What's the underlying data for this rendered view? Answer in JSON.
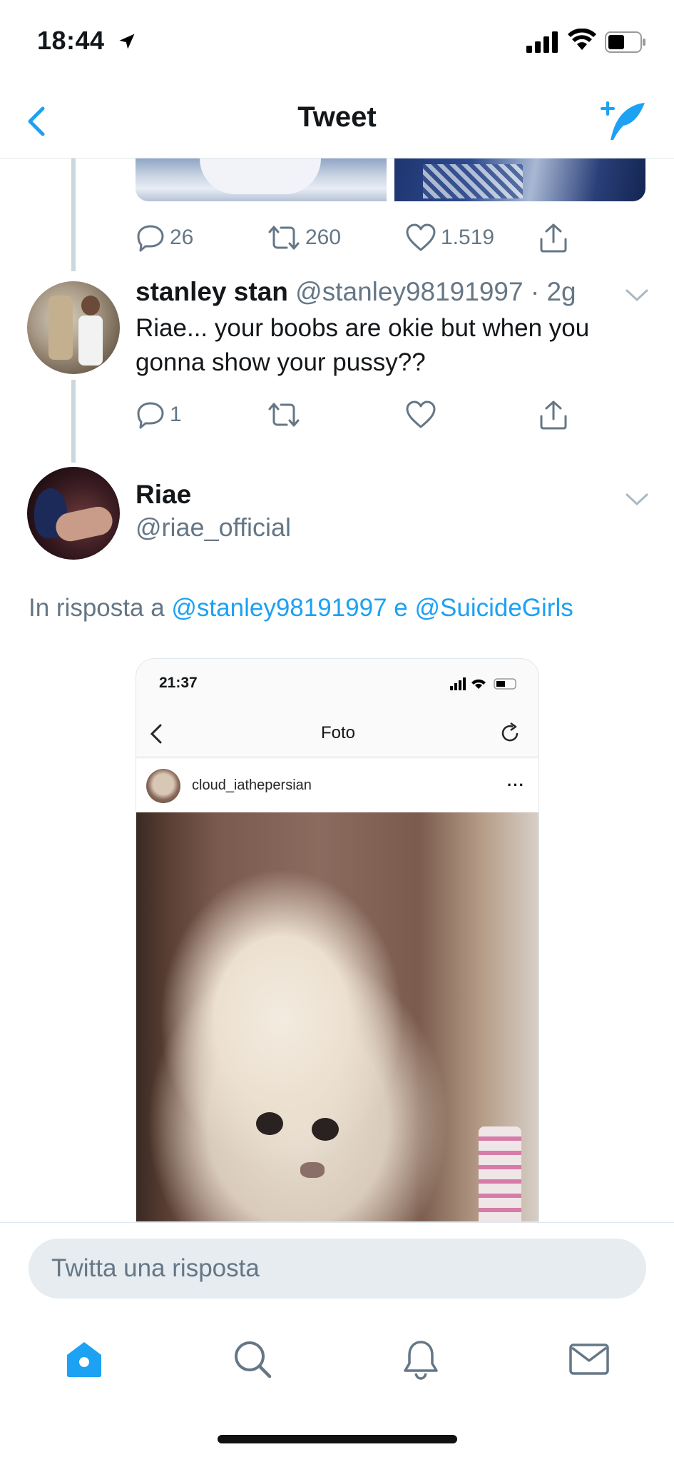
{
  "status_bar": {
    "time": "18:44"
  },
  "nav": {
    "title": "Tweet"
  },
  "parent_tweet_actions": {
    "replies": "26",
    "retweets": "260",
    "likes": "1.519"
  },
  "reply_tweet": {
    "name": "stanley stan",
    "handle": "@stanley98191997",
    "time": "· 2g",
    "text": "Riae... your boobs are okie but when you gonna show your pussy??",
    "replies": "1"
  },
  "main_tweet": {
    "name": "Riae",
    "handle": "@riae_official",
    "reply_prefix": "In risposta a",
    "reply_user_1": "@stanley98191997",
    "reply_joiner": "e",
    "reply_user_2": "@SuicideGirls",
    "embedded_screenshot": {
      "time": "21:37",
      "title": "Foto",
      "username": "cloud_iathepersian",
      "menu": "···"
    }
  },
  "reply_bar": {
    "placeholder": "Twitta una risposta"
  },
  "colors": {
    "accent": "#1da1f2",
    "secondary_text": "#657786",
    "divider": "#e1e8ed"
  },
  "tabs": [
    "home-icon",
    "search-icon",
    "notifications-icon",
    "messages-icon"
  ]
}
